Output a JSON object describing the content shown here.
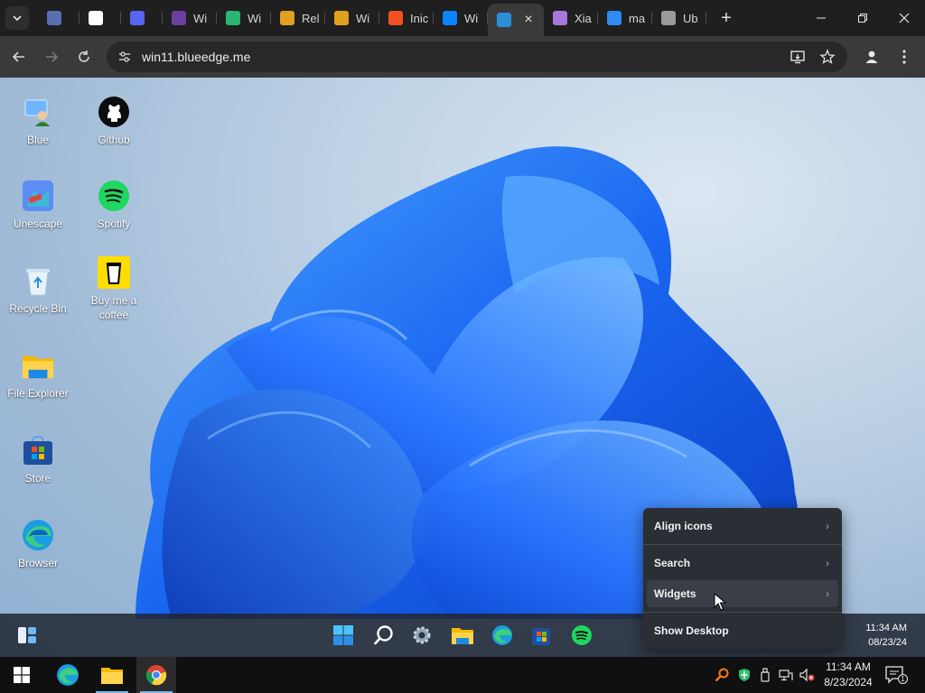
{
  "browser": {
    "tabs": [
      {
        "label": "",
        "icon": "kyber-icon",
        "color": "#5a6fb0"
      },
      {
        "label": "",
        "icon": "github-icon",
        "color": "#ffffff"
      },
      {
        "label": "",
        "icon": "discord-icon",
        "color": "#5865f2"
      },
      {
        "label": "Wi",
        "icon": "windows-logo-icon",
        "color": "#6b3fa0"
      },
      {
        "label": "Wi",
        "icon": "sheet-icon",
        "color": "#2bb673"
      },
      {
        "label": "Rel",
        "icon": "windows-xp-logo-icon",
        "color": "#e0a020"
      },
      {
        "label": "Wi",
        "icon": "windows-xp-logo-icon",
        "color": "#e0a020"
      },
      {
        "label": "Inic",
        "icon": "windows-logo-icon",
        "color": "#f25022"
      },
      {
        "label": "Wi",
        "icon": "windows-11-icon",
        "color": "#0a84ff"
      },
      {
        "label": "",
        "icon": "win11-blueedge-icon",
        "color": "#2a8fd8",
        "active": true
      },
      {
        "label": "Xia",
        "icon": "xiaomi-icon",
        "color": "#a678d8"
      },
      {
        "label": "ma",
        "icon": "finder-icon",
        "color": "#2f8cf0"
      },
      {
        "label": "Ub",
        "icon": "settings-icon",
        "color": "#9a9a9a"
      }
    ],
    "url": "win11.blueedge.me"
  },
  "desktop": {
    "icons": [
      {
        "label": "Blue",
        "icon": "blue-user-icon"
      },
      {
        "label": "Github",
        "icon": "github-icon"
      },
      {
        "label": "Unescape",
        "icon": "unescape-icon"
      },
      {
        "label": "Spotify",
        "icon": "spotify-icon"
      },
      {
        "label": "Recycle Bin",
        "icon": "recycle-bin-icon"
      },
      {
        "label": "Buy me a coffee",
        "icon": "coffee-icon"
      },
      {
        "label": "File Explorer",
        "icon": "folder-icon"
      },
      {
        "label": "Store",
        "icon": "store-icon"
      },
      {
        "label": "Browser",
        "icon": "edge-icon"
      }
    ]
  },
  "context_menu": {
    "items": [
      {
        "label": "Align icons",
        "has_submenu": true
      },
      {
        "label": "Search",
        "has_submenu": true
      },
      {
        "label": "Widgets",
        "has_submenu": true,
        "hovered": true
      },
      {
        "label": "Show Desktop",
        "has_submenu": false
      }
    ]
  },
  "inner_taskbar": {
    "apps": [
      "start-icon",
      "search-icon",
      "settings-icon",
      "file-explorer-icon",
      "edge-icon",
      "store-icon",
      "spotify-icon"
    ],
    "time": "11:34 AM",
    "date": "08/23/24"
  },
  "host_taskbar": {
    "apps": [
      "windows-start-icon",
      "edge-icon",
      "file-explorer-icon",
      "chrome-icon"
    ],
    "time": "11:34 AM",
    "date": "8/23/2024",
    "notification_count": "1"
  }
}
